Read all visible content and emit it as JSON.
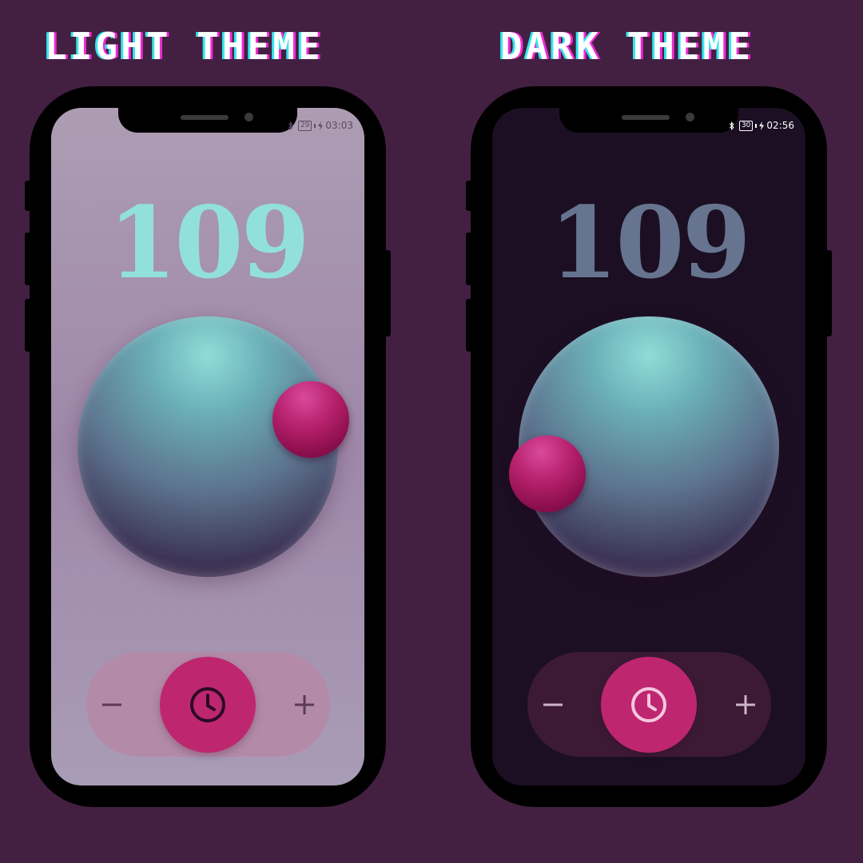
{
  "headings": {
    "light": "LIGHT THEME",
    "dark": "DARK THEME"
  },
  "phones": {
    "light": {
      "status": {
        "battery": "29",
        "time": "03:03"
      },
      "counter": "109",
      "icons": {
        "decrement": "minus-icon",
        "timer": "clock-icon",
        "increment": "plus-icon"
      }
    },
    "dark": {
      "status": {
        "battery": "30",
        "time": "02:56"
      },
      "counter": "109",
      "icons": {
        "decrement": "minus-icon",
        "timer": "clock-icon",
        "increment": "plus-icon"
      }
    }
  },
  "colors": {
    "page_background": "#432042",
    "light_screen": "#a592ab",
    "dark_screen": "#1c0f23",
    "light_counter": "#92e0dc",
    "dark_counter": "#66748f",
    "accent": "#bf2670",
    "light_control_bar": "#b38ba9",
    "dark_control_bar": "#3c1a35"
  }
}
